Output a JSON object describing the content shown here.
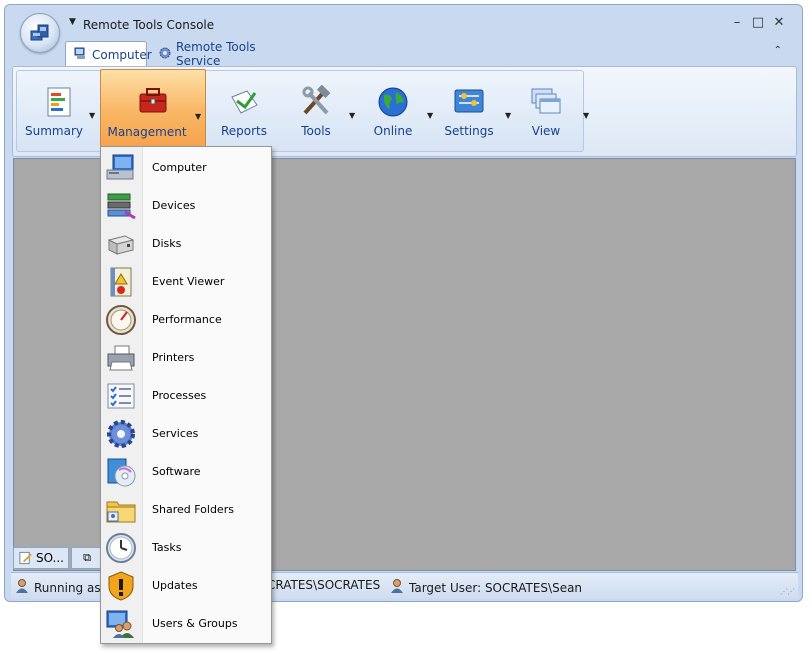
{
  "window": {
    "title": "Remote Tools Console"
  },
  "tabs": [
    {
      "label": "Computer",
      "active": true
    },
    {
      "label": "Remote Tools Service",
      "active": false
    }
  ],
  "ribbon": {
    "buttons": [
      {
        "label": "Summary",
        "icon": "summary-icon",
        "has_dropdown": true
      },
      {
        "label": "Management",
        "icon": "toolbox-icon",
        "has_dropdown": true,
        "pressed": true
      },
      {
        "label": "Reports",
        "icon": "report-icon",
        "has_dropdown": false
      },
      {
        "label": "Tools",
        "icon": "hammer-wrench-icon",
        "has_dropdown": true
      },
      {
        "label": "Online",
        "icon": "globe-icon",
        "has_dropdown": true
      },
      {
        "label": "Settings",
        "icon": "settings-icon",
        "has_dropdown": true
      },
      {
        "label": "View",
        "icon": "windows-icon",
        "has_dropdown": true
      }
    ]
  },
  "management_menu": {
    "items": [
      {
        "label": "Computer",
        "icon": "computer-icon"
      },
      {
        "label": "Devices",
        "icon": "devices-icon"
      },
      {
        "label": "Disks",
        "icon": "disk-icon"
      },
      {
        "label": "Event Viewer",
        "icon": "event-viewer-icon"
      },
      {
        "label": "Performance",
        "icon": "performance-gauge-icon"
      },
      {
        "label": "Printers",
        "icon": "printer-icon"
      },
      {
        "label": "Processes",
        "icon": "processes-icon"
      },
      {
        "label": "Services",
        "icon": "gear-icon"
      },
      {
        "label": "Software",
        "icon": "software-cd-icon"
      },
      {
        "label": "Shared Folders",
        "icon": "shared-folder-icon"
      },
      {
        "label": "Tasks",
        "icon": "clock-icon"
      },
      {
        "label": "Updates",
        "icon": "shield-warning-icon"
      },
      {
        "label": "Users & Groups",
        "icon": "users-icon"
      }
    ]
  },
  "document_tabs": [
    {
      "label": "SO..."
    }
  ],
  "status": {
    "running_as_label": "Running as:",
    "running_as_value": "CRATES\\SOCRATES",
    "target_user": "Target User: SOCRATES\\Sean"
  },
  "colors": {
    "accent": "#15428b",
    "pressed": "#f9b766",
    "workspace": "#a8a8a8"
  }
}
